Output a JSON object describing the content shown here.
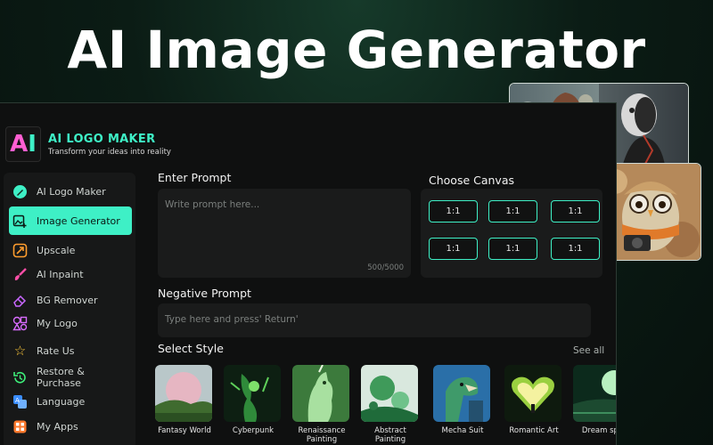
{
  "headline": "AI Image Generator",
  "app": {
    "logo_letters": [
      "A",
      "I"
    ],
    "title": "AI LOGO MAKER",
    "subtitle": "Transform your ideas into reality"
  },
  "sidebar": {
    "items": [
      {
        "label": "AI Logo Maker",
        "icon": "pen-icon",
        "active": false
      },
      {
        "label": "Image Generator",
        "icon": "image-plus-icon",
        "active": true
      },
      {
        "label": "Upscale",
        "icon": "upscale-icon",
        "active": false
      },
      {
        "label": "AI Inpaint",
        "icon": "brush-icon",
        "active": false
      },
      {
        "label": "BG Remover",
        "icon": "eraser-icon",
        "active": false
      },
      {
        "label": "My Logo",
        "icon": "shapes-icon",
        "active": false
      },
      {
        "label": "Rate Us",
        "icon": "star-icon",
        "active": false
      },
      {
        "label": "Restore & Purchase",
        "icon": "restore-icon",
        "active": false
      },
      {
        "label": "Language",
        "icon": "translate-icon",
        "active": false
      },
      {
        "label": "My Apps",
        "icon": "apps-grid-icon",
        "active": false
      }
    ]
  },
  "prompt": {
    "label": "Enter Prompt",
    "placeholder": "Write prompt here...",
    "counter": "500/5000"
  },
  "canvas": {
    "label": "Choose Canvas",
    "ratios": [
      "1:1",
      "1:1",
      "1:1",
      "1:1",
      "1:1",
      "1:1"
    ]
  },
  "negative_prompt": {
    "label": "Negative Prompt",
    "placeholder": "Type here and press' Return'"
  },
  "styles": {
    "label": "Select Style",
    "see_all": "See all",
    "items": [
      {
        "name": "Fantasy World"
      },
      {
        "name": "Cyberpunk"
      },
      {
        "name": "Renaissance Painting"
      },
      {
        "name": "Abstract Painting"
      },
      {
        "name": "Mecha Suit"
      },
      {
        "name": "Romantic Art"
      },
      {
        "name": "Dream spa"
      }
    ]
  },
  "colors": {
    "accent": "#3ef0c6",
    "logo_pink": "#ff5fd2",
    "app_bg": "#0f1010",
    "panel_bg": "#1a1b1b"
  }
}
